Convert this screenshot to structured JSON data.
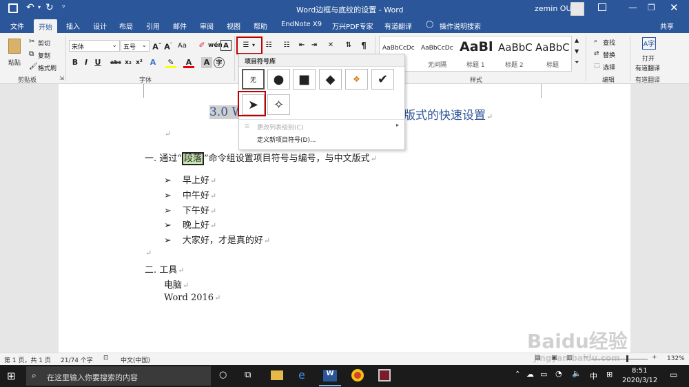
{
  "title": "Word边框与底纹的设置 - Word",
  "user": "zemin OU",
  "tabs": [
    "文件",
    "开始",
    "插入",
    "设计",
    "布局",
    "引用",
    "邮件",
    "审阅",
    "视图",
    "帮助",
    "EndNote X9",
    "万兴PDF专家",
    "有道翻译"
  ],
  "tell_me": "操作说明搜索",
  "share": "共享",
  "clipboard": {
    "paste": "粘贴",
    "cut": "剪切",
    "copy": "复制",
    "format_painter": "格式刷",
    "label": "剪贴板"
  },
  "font": {
    "name": "宋体",
    "size": "五号",
    "label": "字体",
    "aa": "Aa"
  },
  "styles": {
    "label": "样式",
    "items": [
      {
        "preview": "AaBbCcDc",
        "name": ""
      },
      {
        "preview": "AaBbCcDc",
        "name": "无间隔"
      },
      {
        "preview": "AaBl",
        "name": "标题 1"
      },
      {
        "preview": "AaBbC",
        "name": "标题 2"
      },
      {
        "preview": "AaBbC",
        "name": "标题"
      }
    ]
  },
  "editing": {
    "find": "查找",
    "replace": "替换",
    "select": "选择",
    "label": "编辑"
  },
  "youdao": {
    "open": "打开",
    "translate": "有道翻译",
    "label": "有道翻译"
  },
  "dropdown": {
    "header": "项目符号库",
    "none": "无",
    "change_level": "更改列表级别(C)",
    "define_new": "定义新项目符号(D)..."
  },
  "doc": {
    "heading_left": "3.0 W",
    "heading_right": "版式的快速设置",
    "item1_prefix": "一.  通过“",
    "item1_highlight": "段落",
    "item1_suffix": "”命令组设置项目符号与编号，与中文版式",
    "bullets": [
      "早上好",
      "中午好",
      "下午好",
      "晚上好",
      "大家好，才是真的好"
    ],
    "item2": "二.  工具",
    "line_pc": "电脑",
    "line_word": "Word 2016"
  },
  "status": {
    "page": "第 1 页，共 1 页",
    "words": "21/74 个字",
    "lang": "中文(中国)",
    "zoom": "132%"
  },
  "taskbar": {
    "search": "在这里输入你要搜索的内容",
    "ime": "中",
    "time": "8:51",
    "date": "2020/3/12"
  },
  "watermark": {
    "brand": "Baidu经验",
    "url": "jingyan.baidu.com"
  }
}
